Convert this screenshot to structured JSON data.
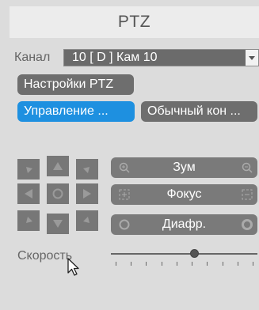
{
  "header": {
    "title": "PTZ"
  },
  "channel": {
    "label": "Канал",
    "value": "10 [ D ] Кам 10"
  },
  "buttons": {
    "ptz_settings": "Настройки PTZ",
    "control": "Управление ...",
    "normal": "Обычный кон ..."
  },
  "controls": {
    "zoom": "Зум",
    "focus": "Фокус",
    "iris": "Диафр."
  },
  "speed": {
    "label": "Скорость",
    "value_fraction": 0.57
  },
  "colors": {
    "accent": "#1e90e0",
    "button": "#6e6e6e",
    "background": "#dcdcdc"
  },
  "icons": [
    "zoom-in-icon",
    "zoom-out-icon",
    "focus-near-icon",
    "focus-far-icon",
    "iris-open-icon",
    "iris-close-icon",
    "arrow-up-icon",
    "arrow-down-icon",
    "arrow-left-icon",
    "arrow-right-icon",
    "auto-rotate-icon",
    "mouse-cursor-icon"
  ]
}
